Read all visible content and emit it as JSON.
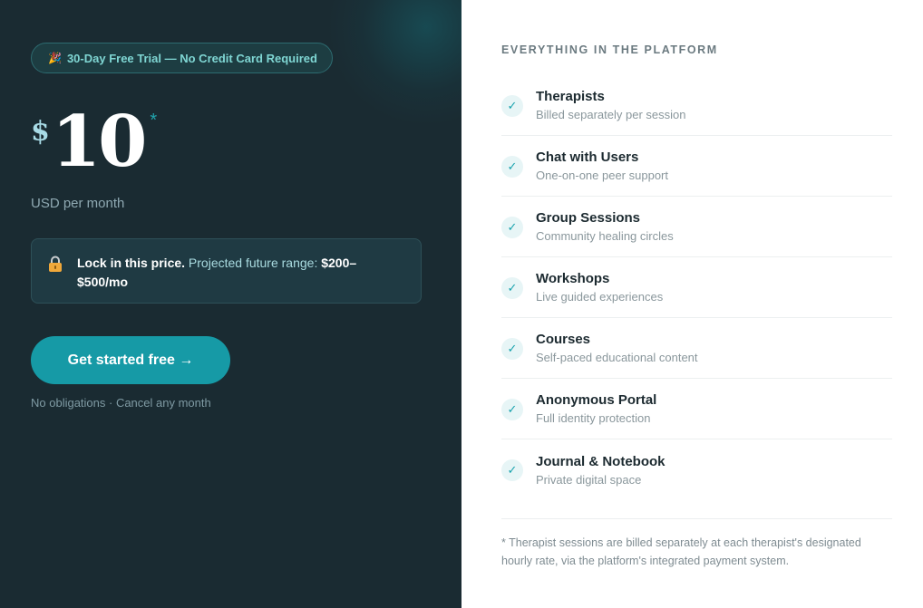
{
  "trial_badge": {
    "icon": "party-popper-icon",
    "label": "30-Day Free Trial — No Credit Card Required"
  },
  "price": {
    "currency": "$",
    "amount": "10",
    "asterisk": "*",
    "period": "USD per month"
  },
  "lock_notice": {
    "icon": "lock-icon",
    "strong": "Lock in this price.",
    "muted": " Projected future range: ",
    "range": "$200–$500/mo"
  },
  "cta": {
    "label": "Get started free →",
    "note": "No obligations · Cancel any month"
  },
  "features_panel": {
    "title": "EVERYTHING IN THE PLATFORM",
    "items": [
      {
        "name": "Therapists",
        "desc": "Billed separately per session"
      },
      {
        "name": "Chat with Users",
        "desc": "One-on-one peer support"
      },
      {
        "name": "Group Sessions",
        "desc": "Community healing circles"
      },
      {
        "name": "Workshops",
        "desc": "Live guided experiences"
      },
      {
        "name": "Courses",
        "desc": "Self-paced educational content"
      },
      {
        "name": "Anonymous Portal",
        "desc": "Full identity protection"
      },
      {
        "name": "Journal & Notebook",
        "desc": "Private digital space"
      }
    ],
    "footnote": "* Therapist sessions are billed separately at each therapist's designated hourly rate, via the platform's integrated payment system."
  },
  "colors": {
    "left_bg": "#1a2b32",
    "accent": "#169aa6",
    "badge_text": "#7fd6d3",
    "check": "#1aa3ae"
  }
}
